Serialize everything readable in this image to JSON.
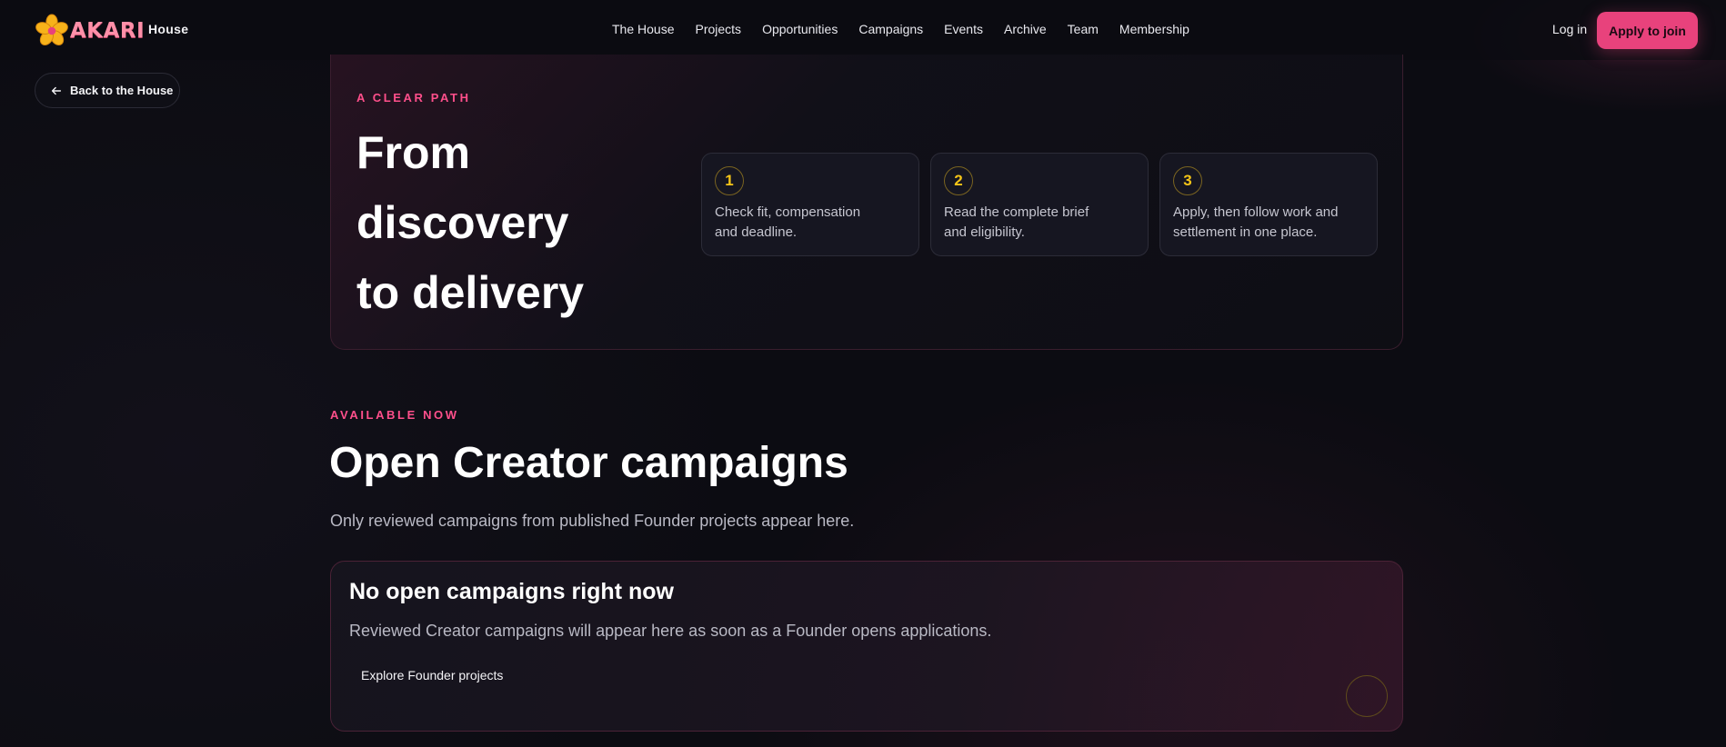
{
  "brand": {
    "name": "AKARI",
    "subtitle": "House",
    "accent": "#e8427c",
    "logo_icon": "flower-icon"
  },
  "nav": {
    "items": [
      "The House",
      "Projects",
      "Opportunities",
      "Campaigns",
      "Events",
      "Archive",
      "Team",
      "Membership"
    ],
    "login_label": "Log in",
    "apply_label": "Apply to join"
  },
  "back": {
    "label": "Back to the House",
    "icon": "arrow-left-icon"
  },
  "path": {
    "eyebrow": "A CLEAR PATH",
    "title_lines": [
      "From",
      "discovery",
      "to delivery"
    ],
    "steps": [
      {
        "number": "1",
        "text": "Check fit, compensation and deadline."
      },
      {
        "number": "2",
        "text": "Read the complete brief and eligibility."
      },
      {
        "number": "3",
        "text": "Apply, then follow work and settlement in one place."
      }
    ]
  },
  "available": {
    "eyebrow": "AVAILABLE NOW",
    "title": "Open Creator campaigns",
    "subtitle": "Only reviewed campaigns from published Founder projects appear here.",
    "empty": {
      "title": "No open campaigns right now",
      "text": "Reviewed Creator campaigns will appear here as soon as a Founder opens applications.",
      "link_label": "Explore Founder projects"
    }
  },
  "colors": {
    "eyebrow": "#ff4f8b",
    "step_number": "#f5c518",
    "background": "#0c0c12"
  }
}
